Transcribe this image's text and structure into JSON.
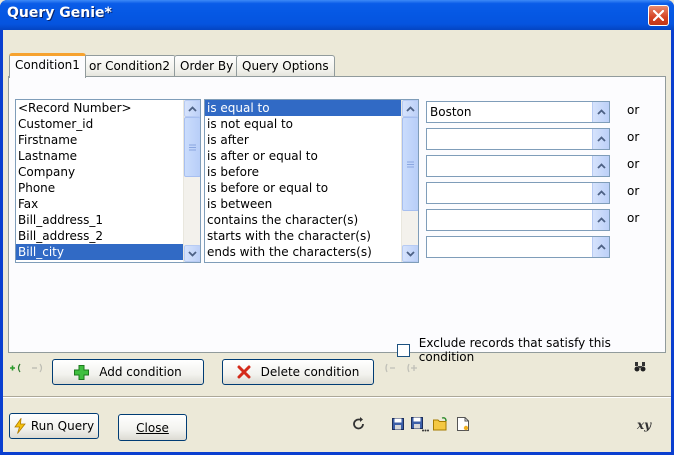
{
  "window": {
    "title": "Query Genie*"
  },
  "tabs": [
    {
      "label": "Condition1"
    },
    {
      "label": "or  Condition2"
    },
    {
      "label": "Order By"
    },
    {
      "label": "Query Options"
    }
  ],
  "fields": {
    "items": [
      "<Record Number>",
      "Customer_id",
      "Firstname",
      "Lastname",
      "Company",
      "Phone",
      "Fax",
      "Bill_address_1",
      "Bill_address_2",
      "Bill_city"
    ],
    "selected": "Bill_city"
  },
  "operators": {
    "items": [
      "is equal to",
      "is not equal to",
      "is after",
      "is after or equal to",
      "is before",
      "is before or equal to",
      "is between",
      "contains the character(s)",
      "starts with the character(s)",
      "ends with the characters(s)"
    ],
    "selected": "is equal to"
  },
  "values": [
    {
      "text": "Boston",
      "or": "or"
    },
    {
      "text": "",
      "or": "or"
    },
    {
      "text": "",
      "or": "or"
    },
    {
      "text": "",
      "or": "or"
    },
    {
      "text": "",
      "or": "or"
    },
    {
      "text": "",
      "or": ""
    }
  ],
  "exclude": {
    "label": "Exclude records that satisfy this condition",
    "checked": false
  },
  "toolbar": {
    "add_label": "Add condition",
    "delete_label": "Delete condition"
  },
  "bottom": {
    "run_label": "Run Query",
    "close_label": "Close",
    "xy_label": "xy"
  },
  "colors": {
    "selection": "#316ac5",
    "titlebar": "#0558e4",
    "tab_accent": "#f6a22f"
  },
  "icons": {
    "close": "close-icon",
    "add": "plus-icon",
    "delete": "x-icon",
    "run": "lightning-icon",
    "undo": "undo-icon",
    "save": "save-icon",
    "open": "folder-icon",
    "new": "new-document-icon",
    "binoculars": "binoculars-icon"
  }
}
